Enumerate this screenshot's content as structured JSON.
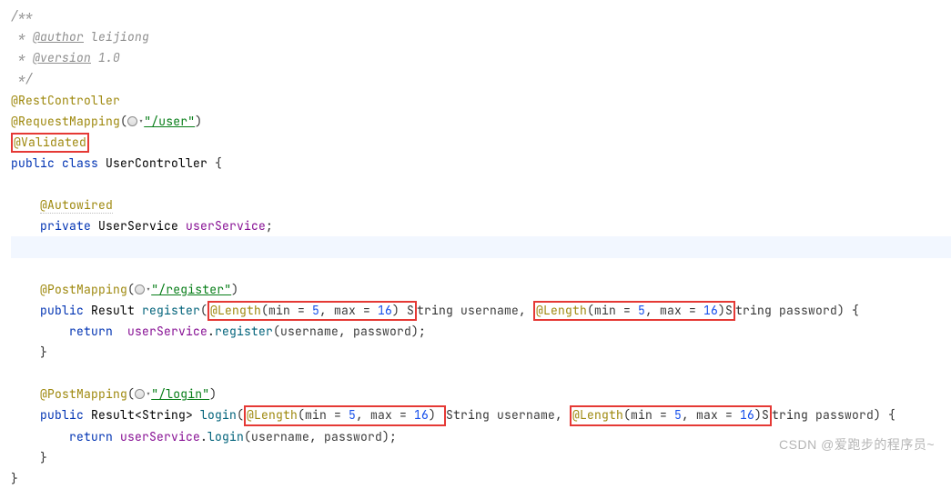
{
  "code": {
    "comment_open": "/**",
    "comment_author": " * @author leijiong",
    "comment_author_prefix": " * ",
    "comment_author_tag": "@author",
    "comment_author_name": " leijiong",
    "comment_version_prefix": " * ",
    "comment_version_tag": "@version",
    "comment_version_val": " 1.0",
    "comment_close": " */",
    "ann_restcontroller": "@RestController",
    "ann_requestmapping": "@RequestMapping",
    "req_mapping_path": "\"/user\"",
    "ann_validated": "@Validated",
    "kw_public": "public",
    "kw_class": "class",
    "class_name": "UserController",
    "brace_open": "{",
    "brace_close": "}",
    "ann_autowired": "@Autowired",
    "kw_private": "private",
    "type_userservice": "UserService",
    "field_userservice": "userService",
    "semicolon": ";",
    "ann_postmapping": "@PostMapping",
    "path_register": "\"/register\"",
    "path_login": "\"/login\"",
    "type_result": "Result",
    "type_result_generic": "Result<String>",
    "method_register": "register",
    "method_login": "login",
    "ann_length": "@Length",
    "length_min_label": "min",
    "length_max_label": "max",
    "length_min_val": "5",
    "length_max_val": "16",
    "type_string": "String",
    "param_username": "username",
    "param_password": "password",
    "kw_return": "return",
    "call_register": "register",
    "call_login": "login",
    "comma_sep": ", ",
    "paren_open": "(",
    "paren_close": ")",
    "equals": " = "
  },
  "watermark": "CSDN @爱跑步的程序员~",
  "icons": {
    "globe": "globe"
  }
}
